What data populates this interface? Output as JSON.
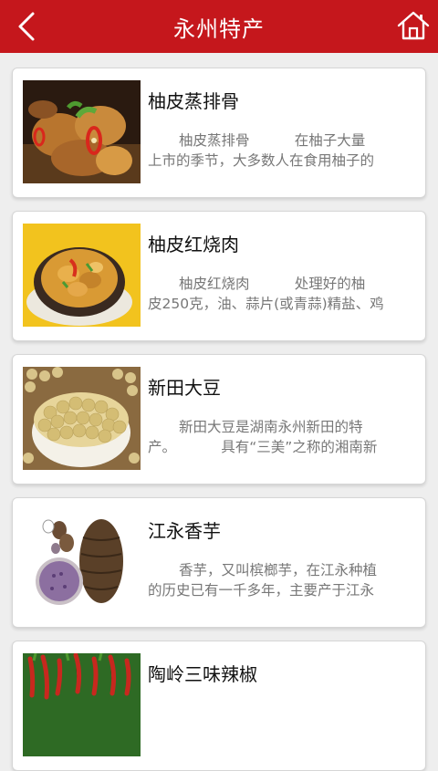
{
  "header": {
    "title": "永州特产"
  },
  "icons": {
    "back": "chevron-left-icon",
    "home": "home-icon"
  },
  "colors": {
    "header_bg": "#c5171c",
    "page_bg": "#eeeeee",
    "card_bg": "#ffffff"
  },
  "items": [
    {
      "title": "柚皮蒸排骨",
      "desc_line1": "柚皮蒸排骨          在柚子大量",
      "desc_line2": "上市的季节，大多数人在食用柚子的"
    },
    {
      "title": "柚皮红烧肉",
      "desc_line1": "柚皮红烧肉          处理好的柚",
      "desc_line2": "皮250克，油、蒜片(或青蒜)精盐、鸡"
    },
    {
      "title": "新田大豆",
      "desc_line1": "新田大豆是湖南永州新田的特",
      "desc_line2": "产。          具有“三美”之称的湘南新"
    },
    {
      "title": "江永香芋",
      "desc_line1": "香芋，又叫槟榔芋，在江永种植",
      "desc_line2": "的历史已有一千多年，主要产于江永"
    },
    {
      "title": "陶岭三味辣椒",
      "desc_line1": "",
      "desc_line2": ""
    }
  ]
}
